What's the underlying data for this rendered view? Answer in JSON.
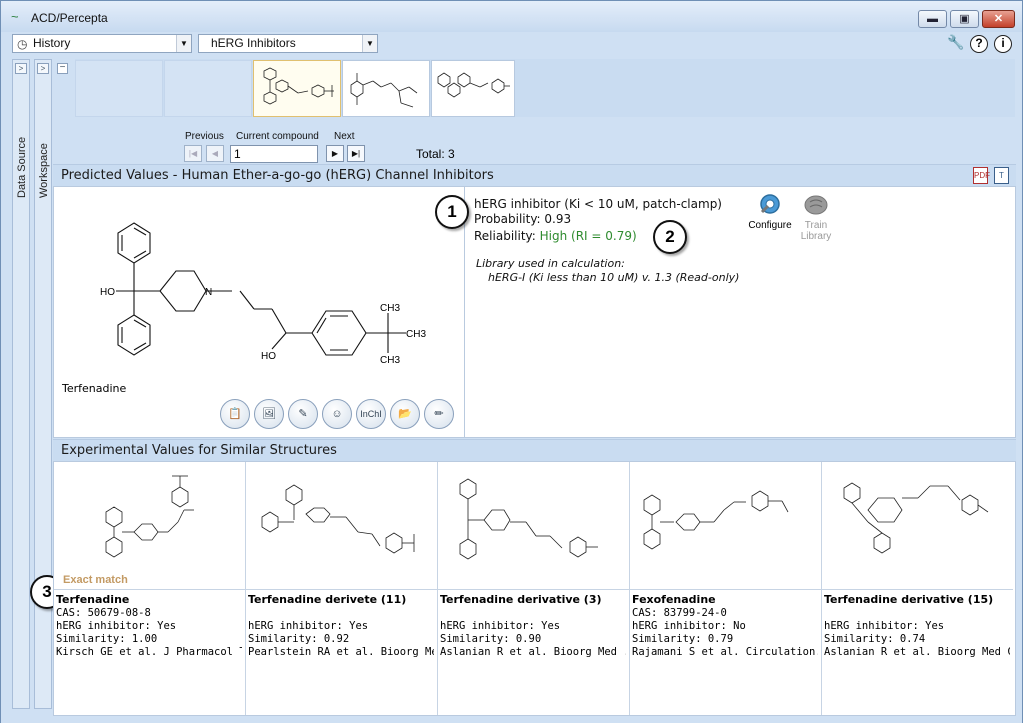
{
  "window": {
    "title": "ACD/Percepta",
    "min_glyph": "▬",
    "max_glyph": "▣",
    "close_glyph": "✕"
  },
  "toolbar": {
    "history_value": "History",
    "module_value": "hERG Inhibitors",
    "icons": [
      "wrench-icon",
      "help-icon",
      "info-icon"
    ],
    "help_glyph": "?",
    "info_glyph": "i"
  },
  "side_tabs": {
    "data_source": "Data Source",
    "workspace": "Workspace"
  },
  "navigation": {
    "previous_label": "Previous",
    "current_label": "Current compound",
    "next_label": "Next",
    "current_value": "1",
    "total": "Total: 3"
  },
  "predicted": {
    "header": "Predicted Values - Human Ether-a-go-go (hERG) Channel Inhibitors",
    "compound_name": "Terfenadine",
    "endpoint": "hERG inhibitor (Ki < 10 uM, patch-clamp)",
    "probability": "Probability: 0.93",
    "reliability_label": "Reliability:",
    "reliability_value": "High (RI = 0.79)",
    "library_intro": "Library used in calculation:",
    "library_name": "hERG-I (Ki less than 10 uM) v. 1.3 (Read-only)",
    "configure_label": "Configure",
    "train_label_1": "Train",
    "train_label_2": "Library",
    "action_buttons": [
      "clipboard-icon",
      "copy-image-icon",
      "edit-structure-icon",
      "smiles-icon",
      "InChI",
      "open-folder-icon",
      "pencil-icon"
    ],
    "inchi_label": "InChI",
    "structure_labels": {
      "ho1": "HO",
      "ho2": "HO",
      "n": "N",
      "ch3a": "CH3",
      "ch3b": "CH3",
      "ch3c": "CH3"
    }
  },
  "callouts": [
    "1",
    "2",
    "3"
  ],
  "experimental": {
    "header": "Experimental Values for Similar Structures",
    "exact_match": "Exact match",
    "cards": [
      {
        "name": "Terfenadine",
        "lines": [
          "CAS: 50679-08-8",
          "hERG inhibitor: Yes",
          "Similarity: 1.00",
          "Kirsch GE et al. J Pharmacol T.."
        ]
      },
      {
        "name": "Terfenadine derivete (11)",
        "lines": [
          "",
          "hERG inhibitor: Yes",
          "Similarity: 0.92",
          "Pearlstein RA et al. Bioorg Me.."
        ]
      },
      {
        "name": "Terfenadine derivative (3)",
        "lines": [
          "",
          "hERG inhibitor: Yes",
          "Similarity: 0.90",
          "Aslanian R et al. Bioorg Med .."
        ]
      },
      {
        "name": "Fexofenadine",
        "lines": [
          "CAS: 83799-24-0",
          "hERG inhibitor: No",
          "Similarity: 0.79",
          "Rajamani S et al. Circulation. .."
        ]
      },
      {
        "name": "Terfenadine derivative (15)",
        "lines": [
          "",
          "hERG inhibitor: Yes",
          "Similarity: 0.74",
          "Aslanian R et al. Bioorg Med C.."
        ]
      }
    ]
  }
}
